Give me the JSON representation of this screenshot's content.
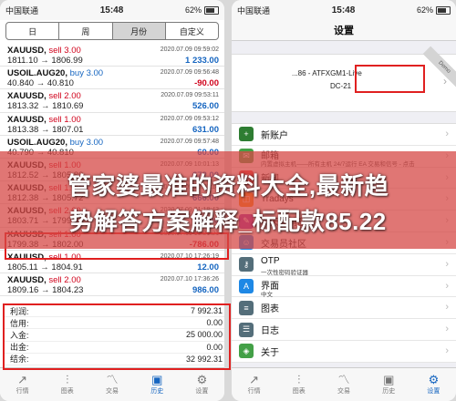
{
  "left_phone": {
    "status": {
      "carrier": "中国联通",
      "time": "15:48",
      "battery": "62%"
    },
    "segments": [
      {
        "label": "日",
        "selected": false
      },
      {
        "label": "周",
        "selected": false
      },
      {
        "label": "月份",
        "selected": true
      },
      {
        "label": "自定义",
        "selected": false
      }
    ],
    "history": [
      {
        "symbol": "XAUUSD,",
        "action": "sell 3.00",
        "side": "sell",
        "prices": "1811.10 → 1806.99",
        "date": "2020.07.09 09:59:02",
        "profit": "1 233.00",
        "profit_sign": "pos"
      },
      {
        "symbol": "USOIL.AUG20,",
        "action": "buy 3.00",
        "side": "buy",
        "prices": "40.840 → 40.810",
        "date": "2020.07.09 09:56:48",
        "profit": "-90.00",
        "profit_sign": "neg"
      },
      {
        "symbol": "XAUUSD,",
        "action": "sell 2.00",
        "side": "sell",
        "prices": "1813.32 → 1810.69",
        "date": "2020.07.09 09:53:11",
        "profit": "526.00",
        "profit_sign": "pos"
      },
      {
        "symbol": "XAUUSD,",
        "action": "sell 1.00",
        "side": "sell",
        "prices": "1813.38 → 1807.01",
        "date": "2020.07.09 09:53:12",
        "profit": "631.00",
        "profit_sign": "pos"
      },
      {
        "symbol": "USOIL.AUG20,",
        "action": "buy 3.00",
        "side": "buy",
        "prices": "40.790 → 40.810",
        "date": "2020.07.09 09:57:48",
        "profit": "60.00",
        "profit_sign": "pos"
      },
      {
        "symbol": "XAUUSD,",
        "action": "sell 1.00",
        "side": "sell",
        "prices": "1812.52 → 1805.80",
        "date": "2020.07.09 10:01:13",
        "profit": "672.00",
        "profit_sign": "pos"
      },
      {
        "symbol": "XAUUSD,",
        "action": "sell 1.00",
        "side": "sell",
        "prices": "1812.38 → 1805.72",
        "date": "2020.07.09 10:01:14",
        "profit": "666.00",
        "profit_sign": "pos"
      },
      {
        "symbol": "XAUUSD,",
        "action": "sell 2.00",
        "side": "sell",
        "prices": "1803.71 → 1799.91",
        "date": "2020.07.09 21:18:43",
        "profit": "760.00",
        "profit_sign": "pos"
      },
      {
        "symbol": "XAUUSD,",
        "action": "sell 1.00",
        "side": "sell",
        "prices": "1799.38 → 1802.00",
        "date": "2020.07.10 16:21:21",
        "profit": "-786.00",
        "profit_sign": "neg"
      },
      {
        "symbol": "XAUUSD,",
        "action": "sell 1.00",
        "side": "sell",
        "prices": "1805.11 → 1804.91",
        "date": "2020.07.10 17:26:19",
        "profit": "12.00",
        "profit_sign": "pos"
      },
      {
        "symbol": "XAUUSD,",
        "action": "sell 2.00",
        "side": "sell",
        "prices": "1809.16 → 1804.23",
        "date": "2020.07.10 17:36:26",
        "profit": "986.00",
        "profit_sign": "pos"
      }
    ],
    "summary": [
      {
        "label": "利润:",
        "value": "7 992.31"
      },
      {
        "label": "信用:",
        "value": "0.00"
      },
      {
        "label": "入金:",
        "value": "25 000.00"
      },
      {
        "label": "出金:",
        "value": "0.00"
      },
      {
        "label": "结余:",
        "value": "32 992.31"
      }
    ],
    "tabs": [
      {
        "label": "行情",
        "icon": "trend-icon",
        "glyph": "↗",
        "active": false
      },
      {
        "label": "图表",
        "icon": "chart-icon",
        "glyph": "⫶",
        "active": false
      },
      {
        "label": "交易",
        "icon": "trade-icon",
        "glyph": "〽",
        "active": false
      },
      {
        "label": "历史",
        "icon": "history-icon",
        "glyph": "▣",
        "active": true
      },
      {
        "label": "设置",
        "icon": "gear-icon",
        "glyph": "⚙",
        "active": false
      }
    ]
  },
  "right_phone": {
    "status": {
      "carrier": "中国联通",
      "time": "15:48",
      "battery": "62%"
    },
    "title": "设置",
    "account": {
      "line1": "...86 - ATFXGM1-Live",
      "line2": "DC-21",
      "ribbon": "Demo"
    },
    "menu": [
      {
        "label": "新账户",
        "sub": "",
        "icon": "add-user-icon",
        "glyph": "+",
        "color": "#2e7d32"
      },
      {
        "label": "邮箱",
        "sub": "内置虚拟主机——所有主机 24/7运行 EA 交易和信号 - 点击",
        "icon": "mail-icon",
        "glyph": "✉",
        "color": "#43a047"
      },
      {
        "label": "新闻",
        "sub": "",
        "icon": "news-icon",
        "glyph": "▤",
        "color": "#e53935"
      },
      {
        "label": "Tradays",
        "sub": "",
        "icon": "calendar-icon",
        "glyph": "◫",
        "color": "#fb8c00"
      },
      {
        "label": "聊天和消息",
        "sub": "",
        "icon": "chat-icon",
        "glyph": "✎",
        "color": "#8e24aa"
      },
      {
        "label": "交易员社区",
        "sub": "",
        "icon": "community-icon",
        "glyph": "☺",
        "color": "#1e88e5"
      },
      {
        "label": "OTP",
        "sub": "一次性密码验证器",
        "icon": "otp-icon",
        "glyph": "⚷",
        "color": "#546e7a"
      },
      {
        "label": "界面",
        "sub": "中文",
        "icon": "language-icon",
        "glyph": "A",
        "color": "#1e88e5"
      },
      {
        "label": "图表",
        "sub": "",
        "icon": "chart-settings-icon",
        "glyph": "≡",
        "color": "#546e7a"
      },
      {
        "label": "日志",
        "sub": "",
        "icon": "log-icon",
        "glyph": "☰",
        "color": "#546e7a"
      },
      {
        "label": "关于",
        "sub": "",
        "icon": "about-icon",
        "glyph": "◈",
        "color": "#43a047"
      }
    ],
    "tabs": [
      {
        "label": "行情",
        "icon": "trend-icon",
        "glyph": "↗",
        "active": false
      },
      {
        "label": "图表",
        "icon": "chart-icon",
        "glyph": "⫶",
        "active": false
      },
      {
        "label": "交易",
        "icon": "trade-icon",
        "glyph": "〽",
        "active": false
      },
      {
        "label": "历史",
        "icon": "history-icon",
        "glyph": "▣",
        "active": false
      },
      {
        "label": "设置",
        "icon": "gear-icon",
        "glyph": "⚙",
        "active": true
      }
    ]
  },
  "banner": {
    "line1": "管家婆最准的资料大全,最新趋",
    "line2": "势解答方案解释_标配款85.22"
  }
}
